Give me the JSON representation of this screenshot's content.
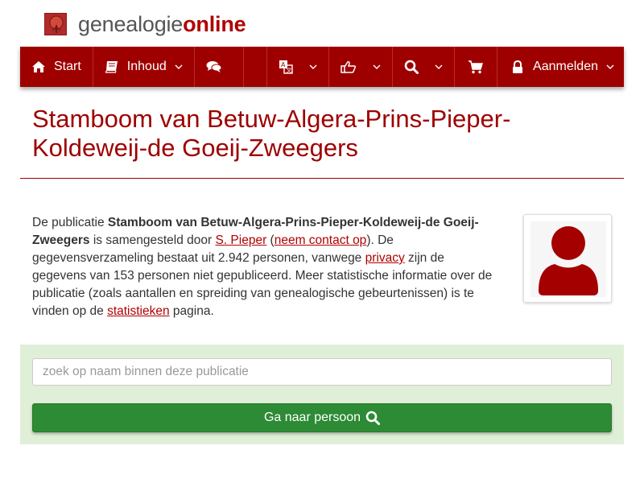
{
  "header": {
    "logo_part1": "genealogie",
    "logo_part2": "online"
  },
  "nav": {
    "start": "Start",
    "inhoud": "Inhoud",
    "aanmelden": "Aanmelden",
    "icons": [
      "home-icon",
      "book-icon",
      "comments-icon",
      "translate-icon",
      "thumbs-up-icon",
      "search-icon",
      "cart-icon",
      "lock-icon"
    ]
  },
  "page": {
    "title": "Stamboom van Betuw-Algera-Prins-Pieper-Koldeweij-de Goeij-Zweegers"
  },
  "description": {
    "t1": "De publicatie ",
    "pub_name": "Stamboom van Betuw-Algera-Prins-Pieper-Koldeweij-de Goeij-Zweegers",
    "t2": " is samengesteld door ",
    "author": "S. Pieper",
    "t3": " (",
    "contact": "neem contact op",
    "t4": "). De gegevensverzameling bestaat uit 2.942 personen, vanwege ",
    "privacy": "privacy",
    "t5": " zijn de gegevens van 153 personen niet gepubliceerd. Meer statistische informatie over de publicatie (zoals aantallen en spreiding van genealogische gebeurtenissen) is te vinden op de ",
    "stats": "statistieken",
    "t6": " pagina."
  },
  "search": {
    "placeholder": "zoek op naam binnen deze publicatie",
    "button_label": "Ga naar persoon"
  },
  "colors": {
    "brand": "#9e0000",
    "button_green": "#2d8a35",
    "panel_green": "#e0efd8"
  }
}
